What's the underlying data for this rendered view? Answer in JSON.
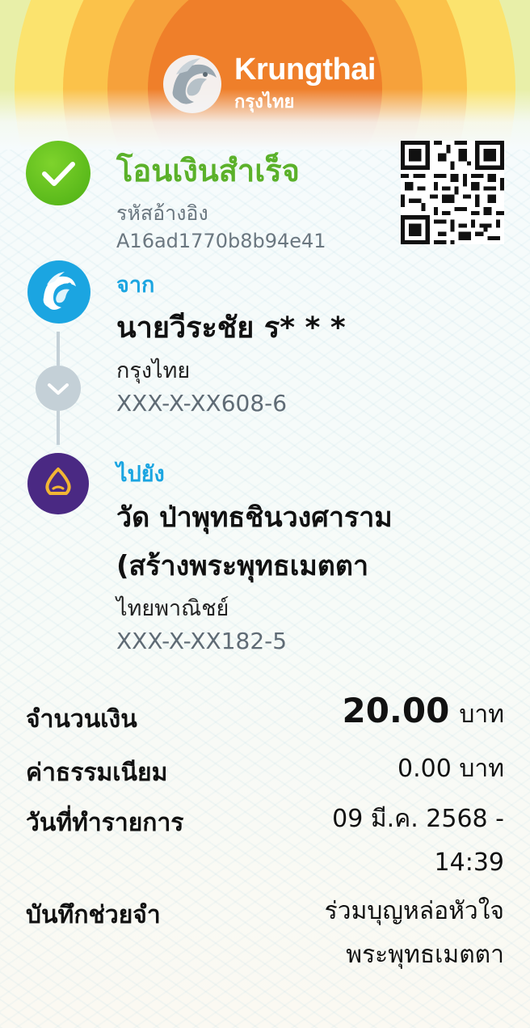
{
  "brand": {
    "name_en": "Krungthai",
    "name_th": "กรุงไทย",
    "colors": {
      "success_green": "#5bb12a",
      "accent_blue": "#1ba5e1",
      "scb_purple": "#4a2983"
    }
  },
  "receipt": {
    "status_title": "โอนเงินสำเร็จ",
    "status_icon": "check-icon",
    "reference_label": "รหัสอ้างอิง",
    "reference_code": "A16ad1770b8b94e41",
    "qr_icon": "qr-code-icon"
  },
  "from": {
    "label": "จาก",
    "name": "นายวีระชัย ร* * *",
    "bank": "กรุงไทย",
    "account": "XXX-X-XX608-6",
    "bank_icon": "krungthai-logo-icon"
  },
  "to": {
    "label": "ไปยัง",
    "name_line1": "วัด ป่าพุทธชินวงศาราม",
    "name_line2": "(สร้างพระพุทธเมตตา",
    "bank": "ไทยพาณิชย์",
    "account": "XXX-X-XX182-5",
    "bank_icon": "scb-logo-icon"
  },
  "details": {
    "amount_label": "จำนวนเงิน",
    "amount_value": "20.00",
    "amount_unit": "บาท",
    "fee_label": "ค่าธรรมเนียม",
    "fee_value": "0.00 บาท",
    "date_label": "วันที่ทำรายการ",
    "date_line1": "09 มี.ค. 2568 -",
    "date_line2": "14:39",
    "memo_label": "บันทึกช่วยจำ",
    "memo_line1": "ร่วมบุญหล่อหัวใจ",
    "memo_line2": "พระพุทธเมตตา"
  }
}
